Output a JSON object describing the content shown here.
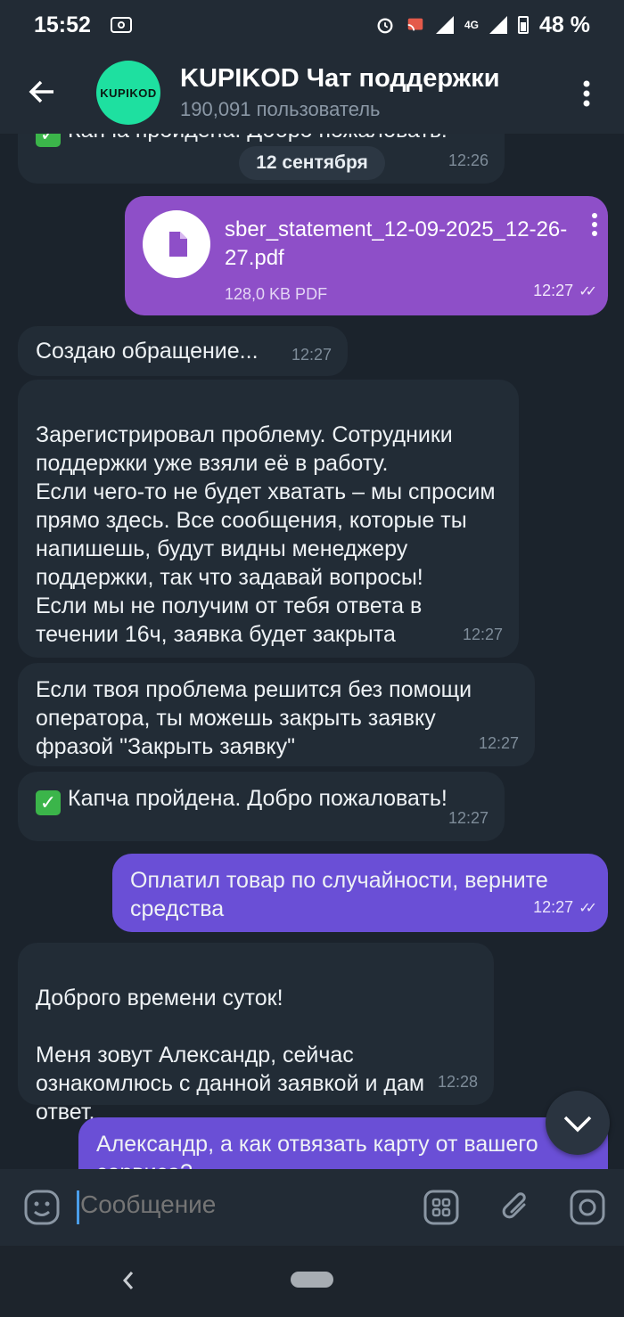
{
  "status_bar": {
    "time": "15:52",
    "network": "4G",
    "battery": "48 %"
  },
  "header": {
    "avatar_text": "KUPIKOD",
    "title": "KUPIKOD Чат поддержки",
    "subtitle": "190,091 пользователь"
  },
  "date_chip": "12 сентября",
  "messages": [
    {
      "text": "Капча пройдена. Добро пожаловать!",
      "time": "12:26"
    },
    {
      "file_name": "sber_statement_12-09-2025_12-26-27.pdf",
      "file_size": "128,0 KB PDF",
      "time": "12:27"
    },
    {
      "text": "Создаю обращение...",
      "time": "12:27"
    },
    {
      "text": "Зарегистрировал проблему. Сотрудники поддержки уже взяли её в работу.\nЕсли чего-то не будет хватать – мы спросим прямо здесь. Все сообщения, которые ты напишешь, будут видны менеджеру поддержки, так что задавай вопросы!\nЕсли мы не получим от тебя ответа в течении 16ч, заявка будет закрыта",
      "time": "12:27"
    },
    {
      "text": "Если твоя проблема решится без помощи оператора, ты можешь закрыть заявку фразой \"Закрыть заявку\"",
      "time": "12:27"
    },
    {
      "text": "Капча пройдена. Добро пожаловать!",
      "time": "12:27"
    },
    {
      "text": "Оплатил товар по случайности, верните средства",
      "time": "12:27"
    },
    {
      "text": "Доброго времени суток!\n\nМеня зовут Александр, сейчас ознакомлюсь с данной заявкой и дам ответ.",
      "time": "12:28"
    },
    {
      "text": "Александр, а как отвязать карту от вашего сервиса?"
    }
  ],
  "input": {
    "placeholder": "Сообщение"
  },
  "colors": {
    "accent": "#6a4fd6",
    "avatar": "#1ee0a0",
    "background": "#1b232c"
  }
}
